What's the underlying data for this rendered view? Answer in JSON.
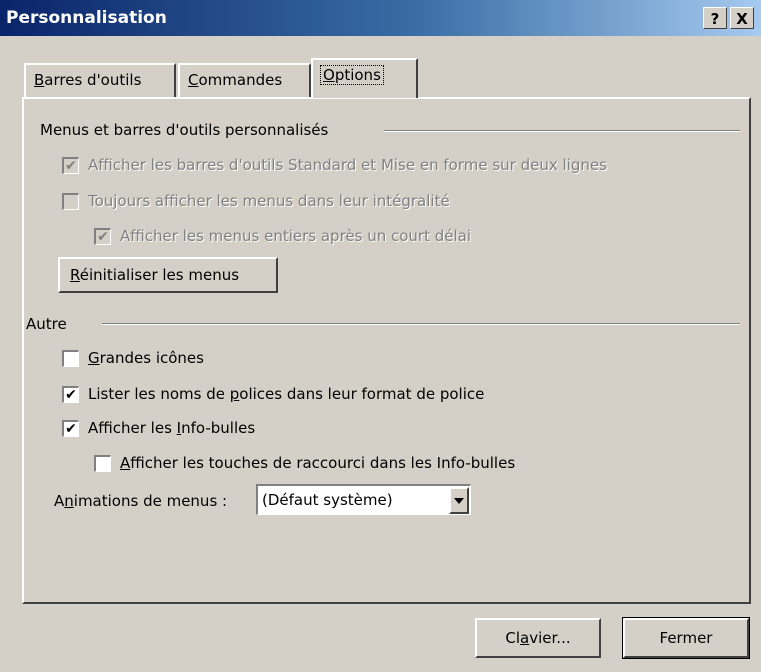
{
  "window": {
    "title": "Personnalisation",
    "help_glyph": "?",
    "close_glyph": "X"
  },
  "tabs": [
    {
      "mn": "B",
      "rest": "arres d'outils"
    },
    {
      "mn": "C",
      "rest": "ommandes"
    },
    {
      "mn": "O",
      "rest": "ptions"
    }
  ],
  "group_menus": {
    "title": "Menus et barres d'outils personnalisés",
    "standard_two_lines": {
      "label": "Afficher les barres d'outils Standard et Mise en forme sur deux lignes",
      "checked": true,
      "enabled": false
    },
    "full_menus": {
      "label": "Toujours afficher les menus dans leur intégralité",
      "checked": false,
      "enabled": false
    },
    "full_menus_delay": {
      "label": "Afficher les menus entiers après un court délai",
      "checked": true,
      "enabled": false
    },
    "reset_button": {
      "mn": "R",
      "rest": "éinitialiser les menus"
    }
  },
  "group_other": {
    "title": "Autre",
    "large_icons": {
      "mn": "G",
      "rest": "randes icônes",
      "checked": false
    },
    "font_names": {
      "pre": "Lister les noms de ",
      "mn": "p",
      "rest": "olices dans leur format de police",
      "checked": true
    },
    "tooltips": {
      "pre": "Afficher les ",
      "mn": "I",
      "rest": "nfo-bulles",
      "checked": true
    },
    "shortcut_keys": {
      "mn": "A",
      "rest": "fficher les touches de raccourci dans les Info-bulles",
      "checked": false
    },
    "animations": {
      "pre": "A",
      "mn": "n",
      "rest": "imations de menus :",
      "value": "(Défaut système)"
    }
  },
  "footer": {
    "keyboard": {
      "pre": "Cl",
      "mn": "a",
      "rest": "vier..."
    },
    "close": "Fermer"
  },
  "check_glyph": "✔"
}
